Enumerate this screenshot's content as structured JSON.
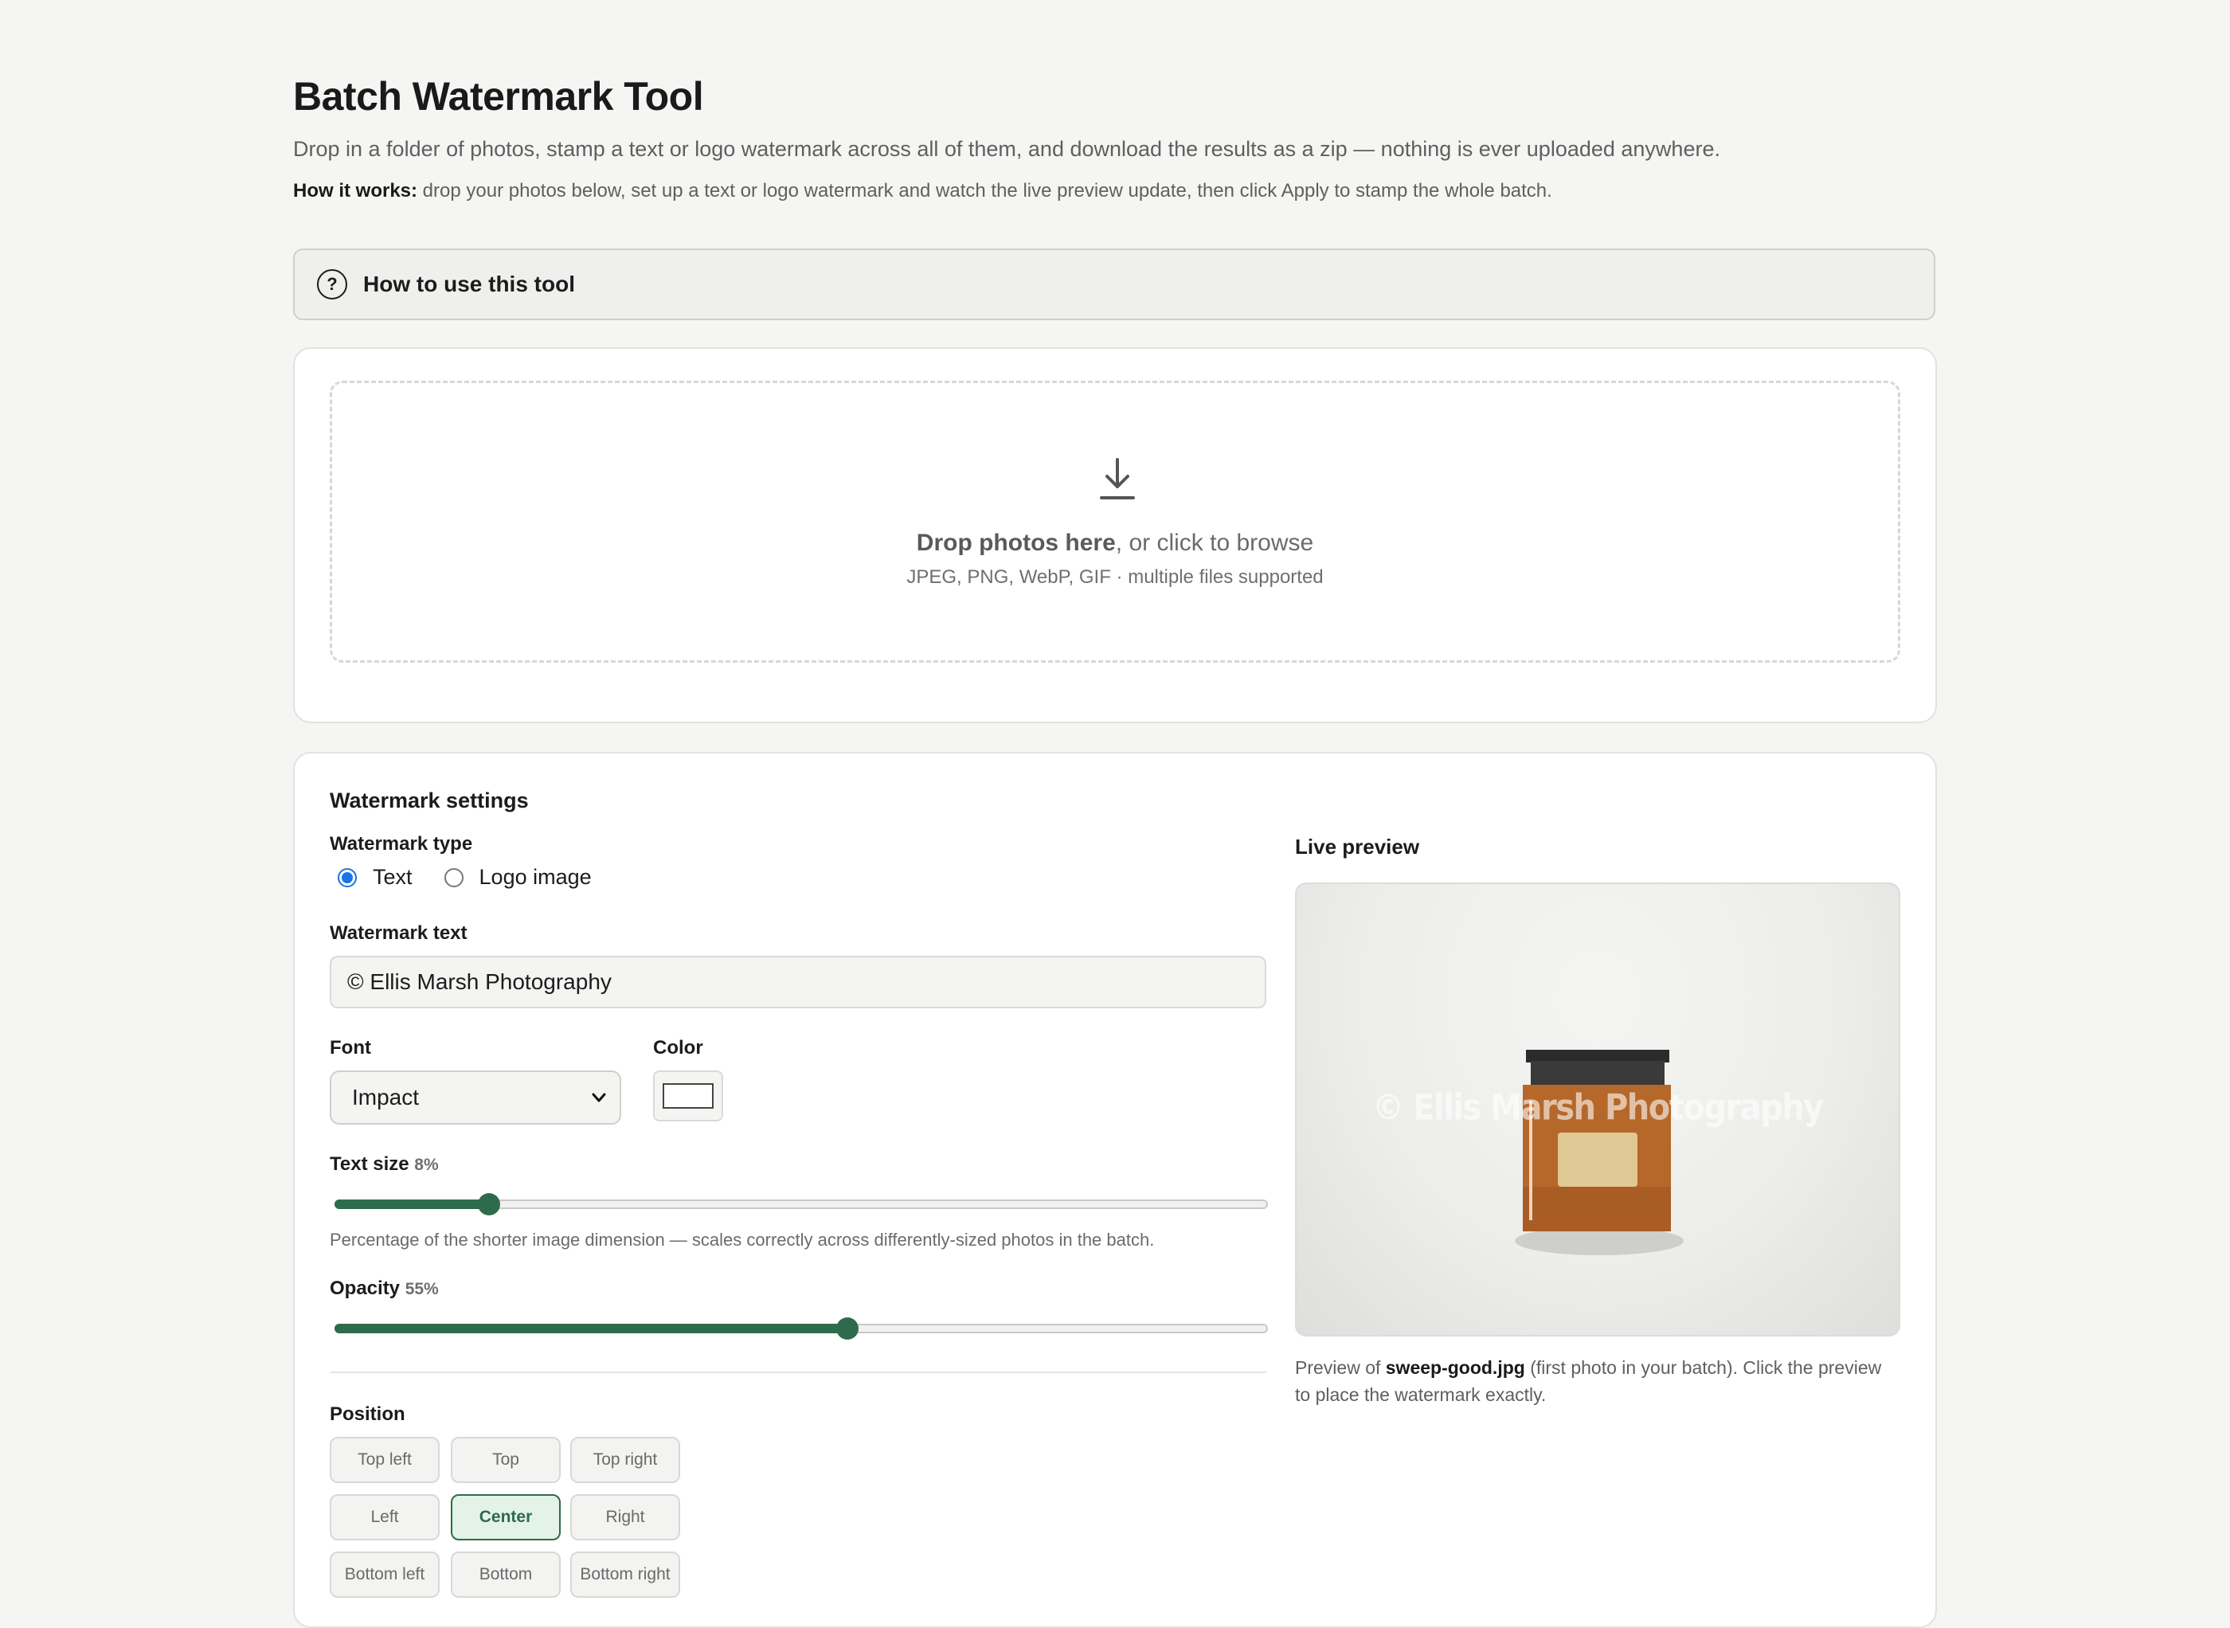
{
  "header": {
    "title": "Batch Watermark Tool",
    "subtitle": "Drop in a folder of photos, stamp a text or logo watermark across all of them, and download the results as a zip — nothing is ever uploaded anywhere.",
    "how_label": "How it works:",
    "how_text": " drop your photos below, set up a text or logo watermark and watch the live preview update, then click Apply to stamp the whole batch."
  },
  "howto": {
    "label": "How to use this tool",
    "icon": "help-circle-icon"
  },
  "upload": {
    "icon": "download-arrow-icon",
    "main_bold": "Drop photos here",
    "main_rest": ", or click to browse",
    "sub": "JPEG, PNG, WebP, GIF · multiple files supported"
  },
  "settings": {
    "title": "Watermark settings",
    "type_label": "Watermark type",
    "type_options": [
      "Text",
      "Logo image"
    ],
    "type_selected": "Text",
    "text_label": "Watermark text",
    "text_value": "© Ellis Marsh Photography",
    "font_label": "Font",
    "font_value": "Impact",
    "color_label": "Color",
    "color_value": "#ffffff",
    "size_label": "Text size",
    "size_value": 8,
    "size_pct": "8%",
    "size_hint": "Percentage of the shorter image dimension — scales correctly across differently-sized photos in the batch.",
    "opacity_label": "Opacity",
    "opacity_value": 55,
    "opacity_pct": "55%",
    "position_label": "Position",
    "positions": [
      "Top left",
      "Top",
      "Top right",
      "Left",
      "Center",
      "Right",
      "Bottom left",
      "Bottom",
      "Bottom right"
    ],
    "position_selected": "Center"
  },
  "preview": {
    "label": "Live preview",
    "watermark_text": "© Ellis Marsh Photography",
    "caption_pre": "Preview of ",
    "caption_file": "sweep-good.jpg",
    "caption_post": " (first photo in your batch). Click the preview to place the watermark exactly."
  },
  "colors": {
    "accent": "#2e6b4c",
    "radio": "#1a73e8",
    "jar": "#b5682a",
    "lid": "#2b2b2b",
    "label": "#dfc893"
  }
}
